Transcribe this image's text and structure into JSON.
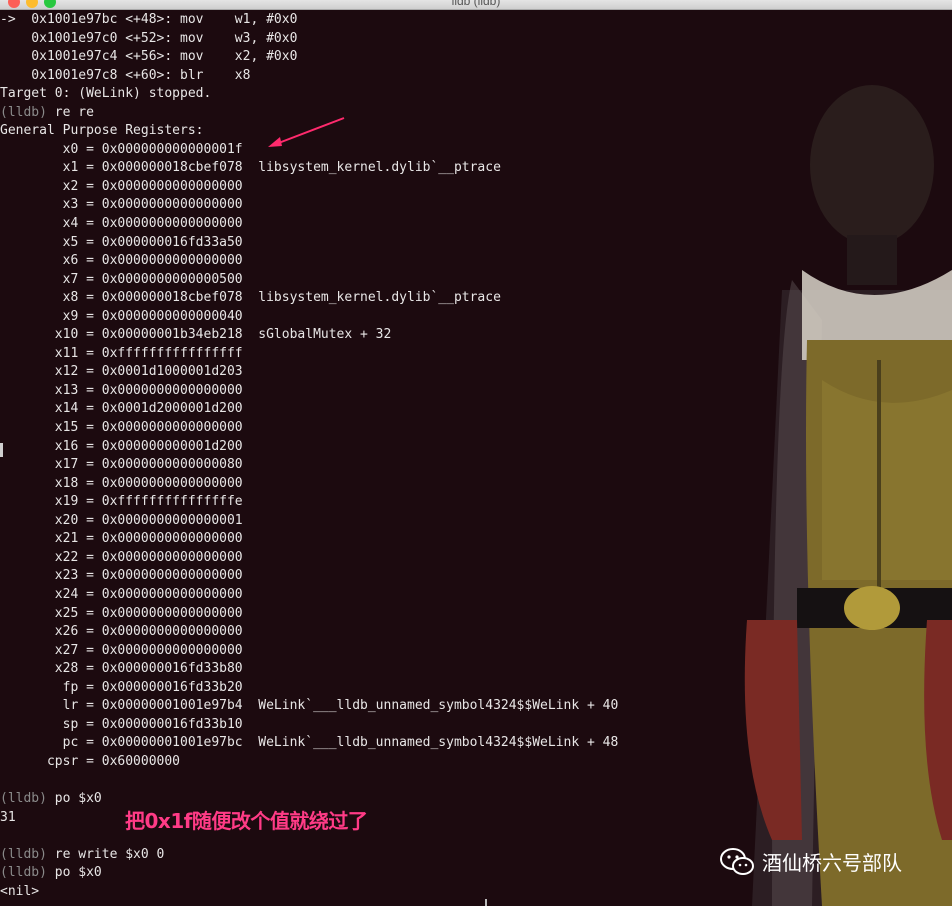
{
  "window": {
    "title": "lldb (lldb)"
  },
  "terminal": {
    "lines": [
      {
        "prompt": "",
        "text": "->  0x1001e97bc <+48>: mov    w1, #0x0"
      },
      {
        "prompt": "",
        "text": "    0x1001e97c0 <+52>: mov    w3, #0x0"
      },
      {
        "prompt": "",
        "text": "    0x1001e97c4 <+56>: mov    x2, #0x0"
      },
      {
        "prompt": "",
        "text": "    0x1001e97c8 <+60>: blr    x8"
      },
      {
        "prompt": "",
        "text": "Target 0: (WeLink) stopped."
      },
      {
        "prompt": "(lldb)",
        "text": " re re"
      },
      {
        "prompt": "",
        "text": "General Purpose Registers:"
      },
      {
        "prompt": "",
        "text": "        x0 = 0x000000000000001f"
      },
      {
        "prompt": "",
        "text": "        x1 = 0x000000018cbef078  libsystem_kernel.dylib`__ptrace"
      },
      {
        "prompt": "",
        "text": "        x2 = 0x0000000000000000"
      },
      {
        "prompt": "",
        "text": "        x3 = 0x0000000000000000"
      },
      {
        "prompt": "",
        "text": "        x4 = 0x0000000000000000"
      },
      {
        "prompt": "",
        "text": "        x5 = 0x000000016fd33a50"
      },
      {
        "prompt": "",
        "text": "        x6 = 0x0000000000000000"
      },
      {
        "prompt": "",
        "text": "        x7 = 0x0000000000000500"
      },
      {
        "prompt": "",
        "text": "        x8 = 0x000000018cbef078  libsystem_kernel.dylib`__ptrace"
      },
      {
        "prompt": "",
        "text": "        x9 = 0x0000000000000040"
      },
      {
        "prompt": "",
        "text": "       x10 = 0x00000001b34eb218  sGlobalMutex + 32"
      },
      {
        "prompt": "",
        "text": "       x11 = 0xffffffffffffffff"
      },
      {
        "prompt": "",
        "text": "       x12 = 0x0001d1000001d203"
      },
      {
        "prompt": "",
        "text": "       x13 = 0x0000000000000000"
      },
      {
        "prompt": "",
        "text": "       x14 = 0x0001d2000001d200"
      },
      {
        "prompt": "",
        "text": "       x15 = 0x0000000000000000"
      },
      {
        "prompt": "",
        "text": "       x16 = 0x000000000001d200"
      },
      {
        "prompt": "",
        "text": "       x17 = 0x0000000000000080"
      },
      {
        "prompt": "",
        "text": "       x18 = 0x0000000000000000"
      },
      {
        "prompt": "",
        "text": "       x19 = 0xfffffffffffffffe"
      },
      {
        "prompt": "",
        "text": "       x20 = 0x0000000000000001"
      },
      {
        "prompt": "",
        "text": "       x21 = 0x0000000000000000"
      },
      {
        "prompt": "",
        "text": "       x22 = 0x0000000000000000"
      },
      {
        "prompt": "",
        "text": "       x23 = 0x0000000000000000"
      },
      {
        "prompt": "",
        "text": "       x24 = 0x0000000000000000"
      },
      {
        "prompt": "",
        "text": "       x25 = 0x0000000000000000"
      },
      {
        "prompt": "",
        "text": "       x26 = 0x0000000000000000"
      },
      {
        "prompt": "",
        "text": "       x27 = 0x0000000000000000"
      },
      {
        "prompt": "",
        "text": "       x28 = 0x000000016fd33b80"
      },
      {
        "prompt": "",
        "text": "        fp = 0x000000016fd33b20"
      },
      {
        "prompt": "",
        "text": "        lr = 0x00000001001e97b4  WeLink`___lldb_unnamed_symbol4324$$WeLink + 40"
      },
      {
        "prompt": "",
        "text": "        sp = 0x000000016fd33b10"
      },
      {
        "prompt": "",
        "text": "        pc = 0x00000001001e97bc  WeLink`___lldb_unnamed_symbol4324$$WeLink + 48"
      },
      {
        "prompt": "",
        "text": "      cpsr = 0x60000000"
      },
      {
        "prompt": "",
        "text": ""
      },
      {
        "prompt": "(lldb)",
        "text": " po $x0"
      },
      {
        "prompt": "",
        "text": "31"
      },
      {
        "prompt": "",
        "text": ""
      },
      {
        "prompt": "(lldb)",
        "text": " re write $x0 0"
      },
      {
        "prompt": "(lldb)",
        "text": " po $x0"
      },
      {
        "prompt": "",
        "text": "<nil>"
      }
    ]
  },
  "annotation": {
    "text": "把0x1f随便改个值就绕过了",
    "color": "#ff3b86"
  },
  "watermark": {
    "text": "酒仙桥六号部队",
    "icon": "wechat-icon"
  },
  "colors": {
    "background": "#1c0a0f",
    "text": "#e8e6e6",
    "prompt": "#8a8a8a",
    "arrow": "#ff2a6d"
  }
}
